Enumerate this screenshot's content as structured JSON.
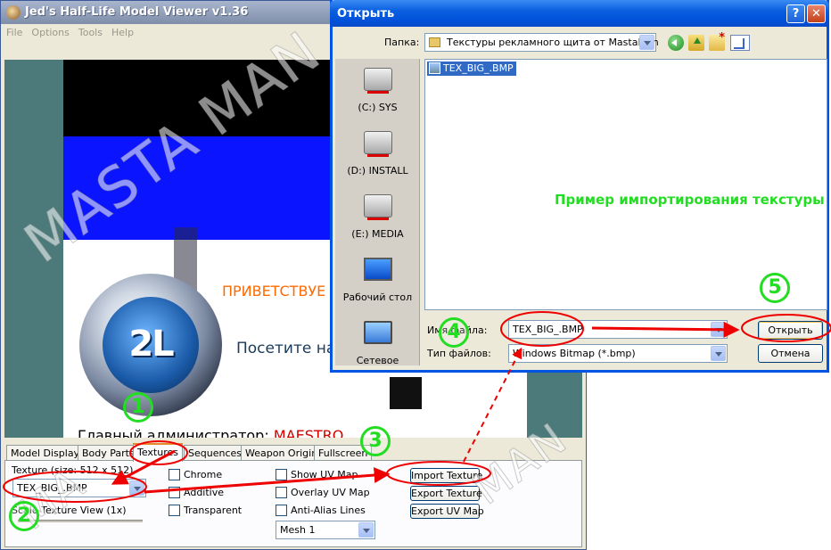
{
  "viewer": {
    "title": "Jed's Half-Life Model Viewer v1.36",
    "menu": [
      "File",
      "Options",
      "Tools",
      "Help"
    ],
    "greeting": "ПРИВЕТСТВУЕ",
    "visit": "Посетите на",
    "admin_label": "Главный администратор:",
    "admin_name": "MAESTRO",
    "logo_text": "2L",
    "tabs": [
      "Model Display",
      "Body Parts",
      "Textures",
      "Sequences",
      "Weapon Origin",
      "Fullscreen"
    ],
    "texture_label": "Texture (size: 512 x 512)",
    "texture_value": "TEX_BIG_.BMP",
    "scale_label": "Scale Texture View (1x)",
    "checks_left": [
      "Chrome",
      "Additive",
      "Transparent"
    ],
    "checks_right": [
      "Show UV Map",
      "Overlay UV Map",
      "Anti-Alias Lines"
    ],
    "mesh_value": "Mesh 1",
    "buttons": [
      "Import Texture",
      "Export Texture",
      "Export UV Map"
    ]
  },
  "dialog": {
    "title": "Открыть",
    "help_glyph": "?",
    "close_glyph": "✕",
    "lookin_label": "Папка:",
    "lookin_value": "Текстуры рекламного щита от MastaMan",
    "places": [
      "(C:) SYS",
      "(D:) INSTALL",
      "(E:) MEDIA",
      "Рабочий стол",
      "Сетевое"
    ],
    "file": "TEX_BIG_.BMP",
    "note": "Пример импортирования текстуры",
    "filename_label": "Имя файла:",
    "filename_value": "TEX_BIG_.BMP",
    "filetype_label": "Тип файлов:",
    "filetype_value": "Windows Bitmap (*.bmp)",
    "open_button": "Открыть",
    "cancel_button": "Отмена"
  },
  "overlay": {
    "watermark": "MASTA MAN",
    "watermark_b": "MA",
    "watermark_c": "MAN",
    "steps": [
      "1",
      "2",
      "3",
      "4",
      "5"
    ]
  },
  "colors": {
    "annotation_red": "#ee0000",
    "annotation_green": "#22dd22",
    "dialog_title": "#0054e3",
    "selection": "#316ac5"
  }
}
